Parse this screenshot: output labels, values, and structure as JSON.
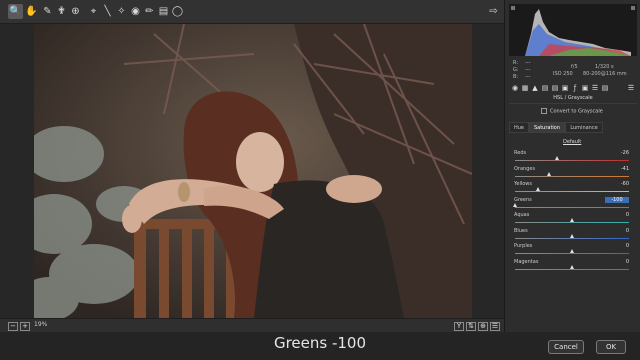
{
  "caption": "Greens -100",
  "buttons": {
    "cancel": "Cancel",
    "ok": "OK"
  },
  "zoom": "19%",
  "camera_info": {
    "r": "R:",
    "g": "G:",
    "b": "B:",
    "dashes": "---",
    "aperture": "f/5",
    "shutter": "1/320 s",
    "iso": "ISO 250",
    "lens": "80-200@116 mm"
  },
  "panel": {
    "section_title": "HSL / Grayscale",
    "convert_label": "Convert to Grayscale",
    "tabs": [
      "Hue",
      "Saturation",
      "Luminance"
    ],
    "active_tab": 1,
    "default_label": "Default",
    "sliders": [
      {
        "label": "Reds",
        "value": "-26",
        "num": -26,
        "gradient": [
          "#8a8a8a",
          "#c0312c"
        ]
      },
      {
        "label": "Oranges",
        "value": "-41",
        "num": -41,
        "gradient": [
          "#8a8a8a",
          "#d27a2a"
        ]
      },
      {
        "label": "Yellows",
        "value": "-60",
        "num": -60,
        "gradient": [
          "#8a8a8a",
          "#d9c52c"
        ]
      },
      {
        "label": "Greens",
        "value": "-100",
        "num": -100,
        "gradient": [
          "#8a8a8a",
          "#3ca43a"
        ],
        "highlight": true
      },
      {
        "label": "Aquas",
        "value": "0",
        "num": 0,
        "gradient": [
          "#8a8a8a",
          "#2fb3b0"
        ]
      },
      {
        "label": "Blues",
        "value": "0",
        "num": 0,
        "gradient": [
          "#8a8a8a",
          "#3566c8"
        ]
      },
      {
        "label": "Purples",
        "value": "0",
        "num": 0,
        "gradient": [
          "#8a8a8a",
          "#8a3ec0"
        ]
      },
      {
        "label": "Magentas",
        "value": "0",
        "num": 0,
        "gradient": [
          "#8a8a8a",
          "#c23a9e"
        ]
      }
    ]
  },
  "tool_icons": [
    "zoom-icon",
    "hand-icon",
    "white-balance-icon",
    "color-sampler-icon",
    "targeted-adjustment-icon",
    "crop-icon",
    "straighten-icon",
    "spot-removal-icon",
    "red-eye-icon",
    "adjustment-brush-icon",
    "graduated-filter-icon",
    "radial-filter-icon"
  ],
  "panel_icons": [
    "basic-icon",
    "tone-curve-icon",
    "detail-icon",
    "hsl-icon",
    "split-toning-icon",
    "lens-icon",
    "effects-icon",
    "camera-calibration-icon",
    "presets-icon",
    "snapshots-icon"
  ]
}
